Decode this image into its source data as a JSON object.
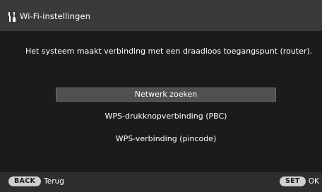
{
  "header": {
    "icon": "tools-icon",
    "title": "Wi-Fi-instellingen"
  },
  "main": {
    "description": "Het systeem maakt verbinding met een draadloos toegangspunt (router).",
    "menu": [
      {
        "label": "Netwerk zoeken",
        "selected": true
      },
      {
        "label": "WPS-drukknopverbinding (PBC)",
        "selected": false
      },
      {
        "label": "WPS-verbinding (pincode)",
        "selected": false
      }
    ]
  },
  "footer": {
    "back_key": "BACK",
    "back_label": "Terug",
    "set_key": "SET",
    "set_label": "OK"
  },
  "colors": {
    "header_bg": "#3a3a3a",
    "main_bg": "#1b1b1b",
    "selected_bg": "#505050",
    "footer_bg": "#2e2e2e",
    "pill_bg": "#cfcfcf"
  }
}
